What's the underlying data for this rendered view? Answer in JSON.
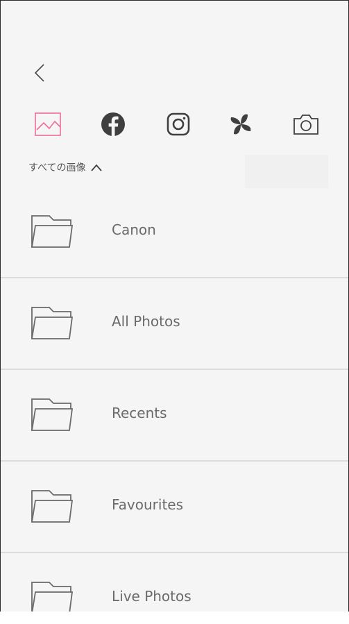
{
  "nav": {
    "back_icon": "chevron-left-icon"
  },
  "sources": [
    {
      "id": "gallery",
      "icon": "image-icon",
      "active": true
    },
    {
      "id": "facebook",
      "icon": "facebook-icon",
      "active": false
    },
    {
      "id": "instagram",
      "icon": "instagram-icon",
      "active": false
    },
    {
      "id": "pinwheel",
      "icon": "pinwheel-icon",
      "active": false
    },
    {
      "id": "camera",
      "icon": "camera-icon",
      "active": false
    }
  ],
  "album_selector": {
    "label": "すべての画像",
    "icon": "chevron-up-icon"
  },
  "folders": [
    {
      "label": "Canon",
      "icon": "folder-icon"
    },
    {
      "label": "All Photos",
      "icon": "folder-icon"
    },
    {
      "label": "Recents",
      "icon": "folder-icon"
    },
    {
      "label": "Favourites",
      "icon": "folder-icon"
    },
    {
      "label": "Live Photos",
      "icon": "folder-icon"
    }
  ],
  "colors": {
    "accent": "#f06c9b",
    "icon": "#4a4a4a",
    "text": "#6a6a6a",
    "divider": "#dcdcdc",
    "background": "#f5f5f5"
  }
}
